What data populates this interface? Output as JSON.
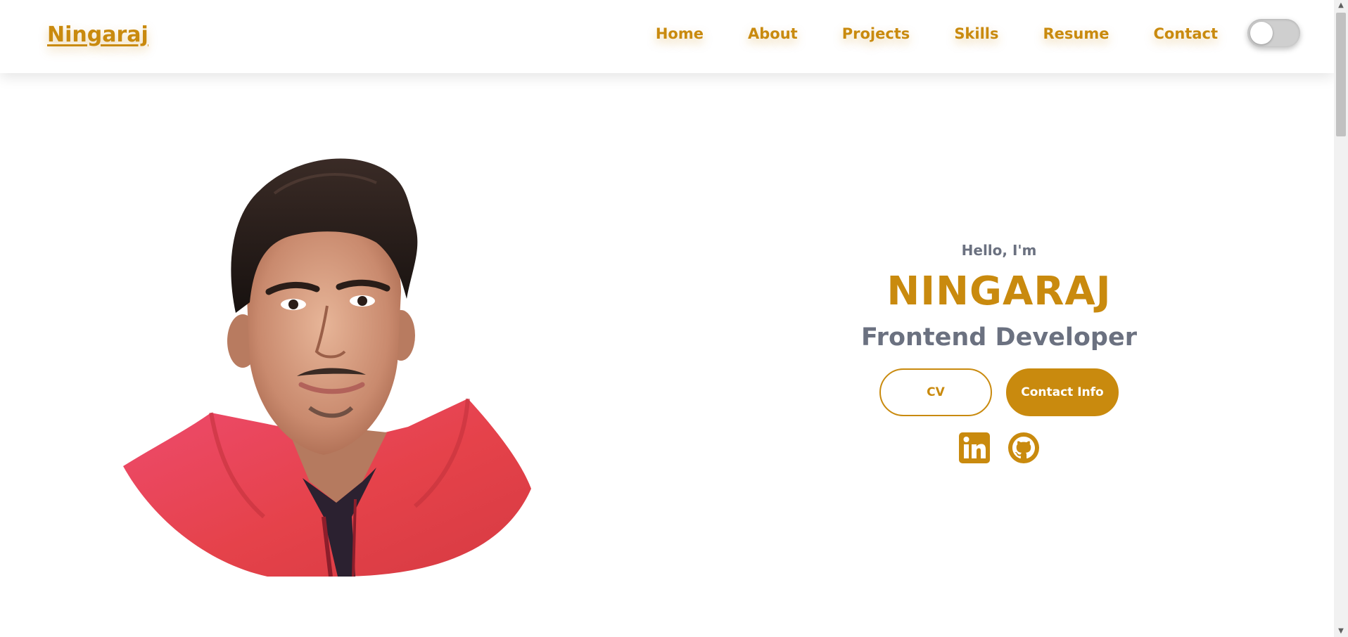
{
  "header": {
    "logo": "Ningaraj",
    "nav": [
      "Home",
      "About",
      "Projects",
      "Skills",
      "Resume",
      "Contact"
    ],
    "theme_toggle": "dark-mode-toggle"
  },
  "hero": {
    "greeting": "Hello, I'm",
    "name": "NINGARAJ",
    "role": "Frontend Developer",
    "buttons": {
      "cv": "CV",
      "contact": "Contact Info"
    },
    "socials": [
      "linkedin-icon",
      "github-icon"
    ]
  },
  "colors": {
    "accent": "#c98a0e",
    "muted_text": "#6b7180",
    "background": "#ffffff",
    "portrait_jacket": "#e5424a"
  }
}
